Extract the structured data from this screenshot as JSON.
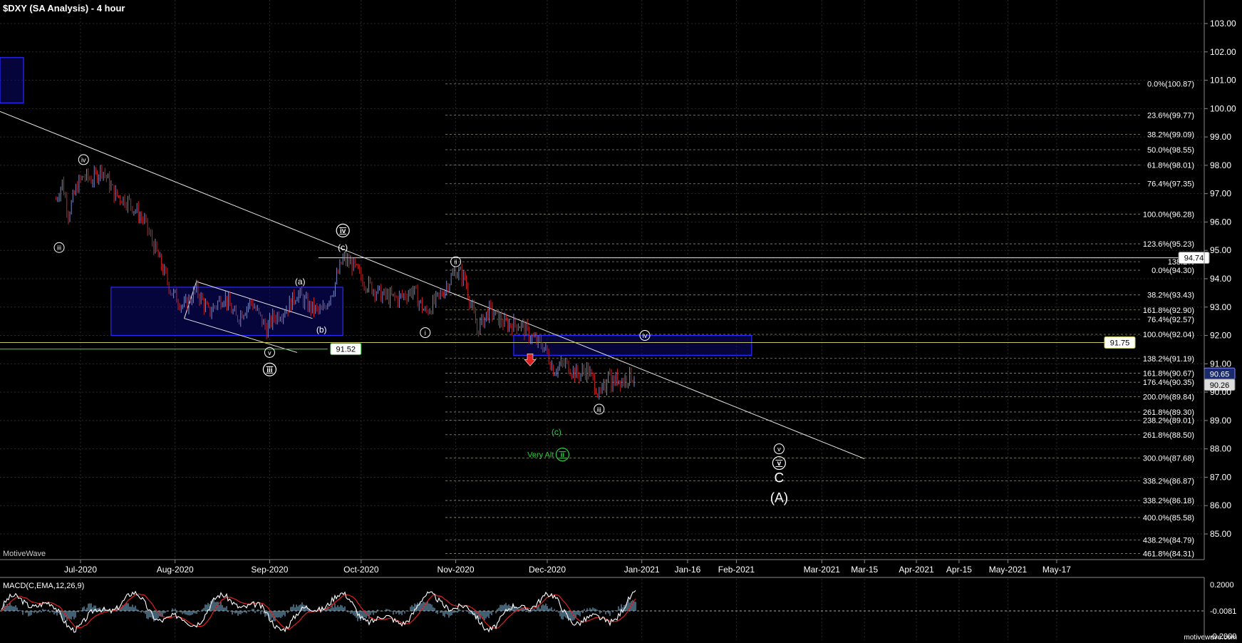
{
  "title": "$DXY (SA Analysis) - 4 hour",
  "watermark": "MotiveWave",
  "footer_brand": "motivewave.com",
  "chart_data": {
    "type": "line",
    "series_kind": "OHLC price bars (4 hour)",
    "x_ticks": [
      "Jul-2020",
      "Aug-2020",
      "Sep-2020",
      "Oct-2020",
      "Nov-2020",
      "Dec-2020",
      "Jan-2021",
      "Jan-16",
      "Feb-2021",
      "Mar-2021",
      "Mar-15",
      "Apr-2021",
      "Apr-15",
      "May-2021",
      "May-17"
    ],
    "y_ticks": [
      "103.00",
      "102.00",
      "101.00",
      "100.00",
      "99.00",
      "98.00",
      "97.00",
      "96.00",
      "95.00",
      "94.00",
      "93.00",
      "92.00",
      "91.00",
      "90.00",
      "89.00",
      "88.00",
      "87.00",
      "86.00",
      "85.00"
    ],
    "ylim": [
      84.2,
      103.4
    ],
    "price_path": [
      {
        "x": "Jun-23",
        "y": 96.8
      },
      {
        "x": "Jun-25",
        "y": 97.4
      },
      {
        "x": "Jun-27",
        "y": 96.3
      },
      {
        "x": "Jun-30",
        "y": 97.3
      },
      {
        "x": "Jul-02",
        "y": 97.6
      },
      {
        "x": "Jul-05",
        "y": 97.5
      },
      {
        "x": "Jul-08",
        "y": 97.9
      },
      {
        "x": "Jul-12",
        "y": 97.0
      },
      {
        "x": "Jul-17",
        "y": 96.7
      },
      {
        "x": "Jul-22",
        "y": 96.0
      },
      {
        "x": "Jul-27",
        "y": 94.6
      },
      {
        "x": "Jul-31",
        "y": 93.5
      },
      {
        "x": "Aug-04",
        "y": 93.0
      },
      {
        "x": "Aug-08",
        "y": 93.6
      },
      {
        "x": "Aug-12",
        "y": 92.8
      },
      {
        "x": "Aug-17",
        "y": 93.4
      },
      {
        "x": "Aug-21",
        "y": 92.6
      },
      {
        "x": "Aug-26",
        "y": 93.2
      },
      {
        "x": "Aug-31",
        "y": 92.2
      },
      {
        "x": "Sep-02",
        "y": 92.6
      },
      {
        "x": "Sep-07",
        "y": 93.0
      },
      {
        "x": "Sep-10",
        "y": 93.5
      },
      {
        "x": "Sep-14",
        "y": 93.0
      },
      {
        "x": "Sep-18",
        "y": 92.8
      },
      {
        "x": "Sep-22",
        "y": 93.7
      },
      {
        "x": "Sep-25",
        "y": 94.7
      },
      {
        "x": "Sep-28",
        "y": 94.5
      },
      {
        "x": "Oct-02",
        "y": 93.9
      },
      {
        "x": "Oct-08",
        "y": 93.4
      },
      {
        "x": "Oct-13",
        "y": 93.3
      },
      {
        "x": "Oct-18",
        "y": 93.6
      },
      {
        "x": "Oct-22",
        "y": 92.8
      },
      {
        "x": "Oct-27",
        "y": 93.4
      },
      {
        "x": "Nov-01",
        "y": 94.3
      },
      {
        "x": "Nov-04",
        "y": 94.0
      },
      {
        "x": "Nov-08",
        "y": 92.2
      },
      {
        "x": "Nov-12",
        "y": 92.9
      },
      {
        "x": "Nov-17",
        "y": 92.4
      },
      {
        "x": "Nov-22",
        "y": 92.4
      },
      {
        "x": "Nov-26",
        "y": 91.9
      },
      {
        "x": "Nov-30",
        "y": 91.6
      },
      {
        "x": "Dec-03",
        "y": 90.8
      },
      {
        "x": "Dec-07",
        "y": 91.0
      },
      {
        "x": "Dec-11",
        "y": 90.6
      },
      {
        "x": "Dec-14",
        "y": 90.8
      },
      {
        "x": "Dec-17",
        "y": 90.2
      },
      {
        "x": "Dec-18",
        "y": 89.8
      },
      {
        "x": "Dec-20",
        "y": 90.2
      },
      {
        "x": "Dec-21",
        "y": 90.9
      },
      {
        "x": "Dec-22",
        "y": 90.3
      },
      {
        "x": "Dec-24",
        "y": 90.5
      },
      {
        "x": "Dec-26",
        "y": 90.4
      },
      {
        "x": "Dec-28",
        "y": 90.6
      },
      {
        "x": "Dec-30",
        "y": 90.5
      }
    ],
    "price_label_left": "91.52",
    "price_label_mid": "91.75",
    "price_label_top": "94.74",
    "last_price_1": "90.65",
    "last_price_2": "90.26",
    "fib_levels": [
      {
        "label": "0.0%(100.87)",
        "color": "#b8b8a0",
        "value": 100.87
      },
      {
        "label": "23.6%(99.77)",
        "color": "#b8b8a0",
        "value": 99.77
      },
      {
        "label": "38.2%(99.09)",
        "color": "#b8b8a0",
        "value": 99.09
      },
      {
        "label": "50.0%(98.55)",
        "color": "#b8b8a0",
        "value": 98.55
      },
      {
        "label": "61.8%(98.01)",
        "color": "#c8c860",
        "value": 98.01
      },
      {
        "label": "76.4%(97.35)",
        "color": "#b8b8a0",
        "value": 97.35
      },
      {
        "label": "100.0%(96.28)",
        "color": "#c8c860",
        "value": 96.28
      },
      {
        "label": "123.6%(95.23)",
        "color": "#b8b8a0",
        "value": 95.23
      },
      {
        "label": "138.2%",
        "color": "#b8b8a0",
        "value": 94.6
      },
      {
        "label": "0.0%(94.30)",
        "color": "#b8b8a0",
        "value": 94.3
      },
      {
        "label": "38.2%(93.43)",
        "color": "#b8b8a0",
        "value": 93.43
      },
      {
        "label": "161.8%(92.90)",
        "color": "#c8c860",
        "value": 92.9
      },
      {
        "label": "76.4%(92.57)",
        "color": "#b8b8a0",
        "value": 92.57
      },
      {
        "label": "100.0%(92.04)",
        "color": "#c8c860",
        "value": 92.04
      },
      {
        "label": "138.2%(91.19)",
        "color": "#b8b8a0",
        "value": 91.19
      },
      {
        "label": "161.8%(90.67)",
        "color": "#c8c860",
        "value": 90.67
      },
      {
        "label": "176.4%(90.35)",
        "color": "#b8b8a0",
        "value": 90.35
      },
      {
        "label": "200.0%(89.84)",
        "color": "#c8c860",
        "value": 89.84
      },
      {
        "label": "261.8%(89.30)",
        "color": "#b8b8a0",
        "value": 89.3
      },
      {
        "label": "238.2%(89.01)",
        "color": "#b8b8a0",
        "value": 89.01
      },
      {
        "label": "261.8%(88.50)",
        "color": "#c8c860",
        "value": 88.5
      },
      {
        "label": "300.0%(87.68)",
        "color": "#c8c860",
        "value": 87.68
      },
      {
        "label": "338.2%(86.87)",
        "color": "#b8b8a0",
        "value": 86.87
      },
      {
        "label": "338.2%(86.18)",
        "color": "#b8b8a0",
        "value": 86.18
      },
      {
        "label": "400.0%(85.58)",
        "color": "#c8c860",
        "value": 85.58
      },
      {
        "label": "438.2%(84.79)",
        "color": "#b8b8a0",
        "value": 84.79
      },
      {
        "label": "461.8%(84.31)",
        "color": "#b8b8a0",
        "value": 84.31
      }
    ],
    "wave_labels": [
      {
        "text": "iii",
        "style": "small-circle",
        "color": "#ffffff",
        "x": "Jun-24",
        "y": 95.1
      },
      {
        "text": "iv",
        "style": "small-circle",
        "color": "#ffffff",
        "x": "Jul-02",
        "y": 98.2
      },
      {
        "text": "a",
        "style": "paren",
        "color": "#ffffff",
        "x": "Sep-11",
        "y": 93.9
      },
      {
        "text": "b",
        "style": "paren",
        "color": "#ffffff",
        "x": "Sep-18",
        "y": 92.2
      },
      {
        "text": "v",
        "style": "small-circle",
        "color": "#ffffff",
        "x": "Sep-01",
        "y": 91.4
      },
      {
        "text": "iii",
        "style": "bold-circle",
        "color": "#ffffff",
        "x": "Sep-01",
        "y": 90.8
      },
      {
        "text": "iv",
        "style": "bold-circle",
        "color": "#ffffff",
        "x": "Sep-25",
        "y": 95.7
      },
      {
        "text": "c",
        "style": "paren",
        "color": "#ffffff",
        "x": "Sep-25",
        "y": 95.1
      },
      {
        "text": "ii",
        "style": "small-circle",
        "color": "#ffffff",
        "x": "Nov-01",
        "y": 94.6
      },
      {
        "text": "i",
        "style": "small-circle",
        "color": "#ffffff",
        "x": "Oct-22",
        "y": 92.1
      },
      {
        "text": "iv",
        "style": "small-circle",
        "color": "#ffffff",
        "x": "Jan-02",
        "y": 92.0
      },
      {
        "text": "iii",
        "style": "small-circle",
        "color": "#ffffff",
        "x": "Dec-18",
        "y": 89.4
      },
      {
        "text": "c",
        "style": "paren",
        "color": "#2ecc40",
        "x": "Dec-04",
        "y": 88.6
      },
      {
        "text": "ii",
        "style": "bold-circle",
        "color": "#2ecc40",
        "x": "Dec-06",
        "y": 87.8
      },
      {
        "text": "v",
        "style": "small-circle",
        "color": "#ffffff",
        "x": "Feb-15",
        "y": 88.0
      },
      {
        "text": "v",
        "style": "bold-circle",
        "color": "#ffffff",
        "x": "Feb-15",
        "y": 87.5
      },
      {
        "text": "C",
        "style": "plain",
        "color": "#ffffff",
        "x": "Feb-15",
        "y": 87.0
      },
      {
        "text": "(A)",
        "style": "plain",
        "color": "#ffffff",
        "x": "Feb-15",
        "y": 86.3
      }
    ],
    "very_alt_label": "Very Alt",
    "macd": {
      "title": "MACD(C,EMA,12,26,9)",
      "value_label": "-0.0081",
      "y_ticks": [
        "0.2000",
        "-0.2000"
      ]
    }
  },
  "colors": {
    "background": "#000000",
    "grid": "#2a2a2a",
    "bar_up": "#7a8cc8",
    "bar_down": "#d02020",
    "trendline": "#e8e8e8",
    "box_fill": "#0a0a6e",
    "box_border": "#2a2aff",
    "green_line": "#22c022",
    "macd_hist": "#7fb8d8",
    "macd_line": "#ffffff",
    "macd_signal": "#e02020"
  }
}
